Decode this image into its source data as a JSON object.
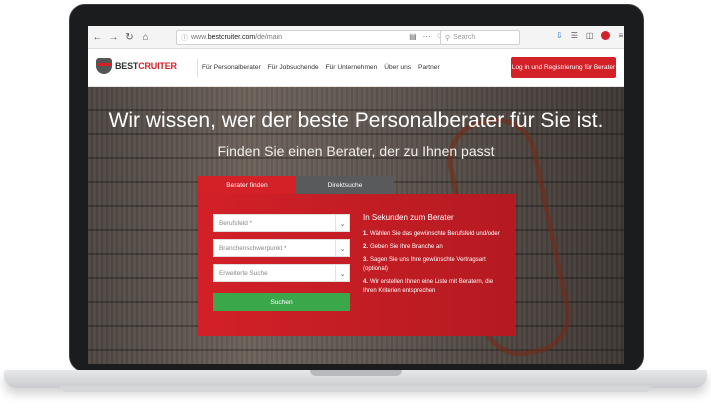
{
  "browser": {
    "url_prefix": "www.",
    "url_host": "bestcruiter.com",
    "url_path": "/de/main",
    "search_placeholder": "Search"
  },
  "site": {
    "logo_best": "BEST",
    "logo_cruiter": "CRUITER",
    "nav": [
      "Für Personalberater",
      "Für Jobsuchende",
      "Für Unternehmen",
      "Über uns",
      "Partner"
    ],
    "login_button": "Log in und Registrierung für Berater"
  },
  "hero": {
    "title": "Wir wissen, wer der beste Personalberater für Sie ist.",
    "subtitle": "Finden Sie einen Berater, der zu Ihnen passt"
  },
  "search_box": {
    "tabs": [
      "Berater finden",
      "Direktsuche"
    ],
    "fields": [
      {
        "placeholder": "Berufsfeld *"
      },
      {
        "placeholder": "Branchenschwerpunkt *"
      },
      {
        "placeholder": "Erweiterte Suche"
      }
    ],
    "submit": "Suchen",
    "info_title": "In Sekunden zum Berater",
    "steps": [
      {
        "num": "1.",
        "text": "Wählen Sie das gewünschte Berufsfeld und/oder"
      },
      {
        "num": "2.",
        "text": "Geben Sie Ihre Branche an"
      },
      {
        "num": "3.",
        "text": "Sagen Sie uns Ihre gewünschte Vertragsart (optional)"
      },
      {
        "num": "4.",
        "text": "Wir erstellen Ihnen eine Liste mit Beratern, die Ihren Kriterien entsprechen"
      }
    ]
  },
  "colors": {
    "accent": "#d42027",
    "submit": "#3aa84a"
  }
}
